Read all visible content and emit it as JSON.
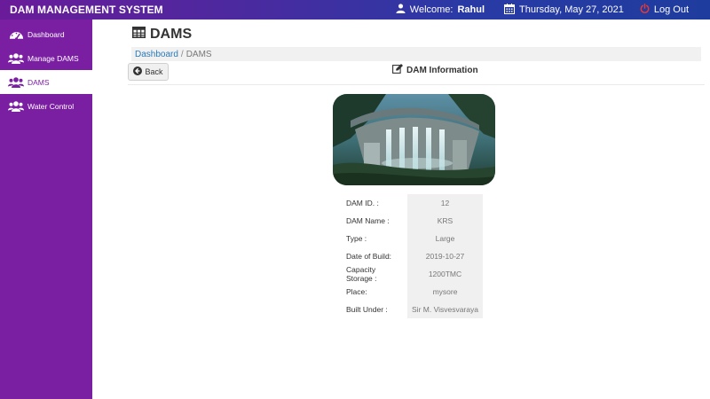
{
  "header": {
    "brand": "DAM MANAGEMENT SYSTEM",
    "welcome_prefix": "Welcome:",
    "user": "Rahul",
    "date": "Thursday, May 27, 2021",
    "logout": "Log Out"
  },
  "sidebar": {
    "items": [
      {
        "label": "Dashboard",
        "icon": "dashboard-icon"
      },
      {
        "label": "Manage DAMS",
        "icon": "users-icon"
      },
      {
        "label": "DAMS",
        "icon": "users-icon",
        "active": true
      },
      {
        "label": "Water Control",
        "icon": "users-icon"
      }
    ]
  },
  "page": {
    "title": "DAMS",
    "breadcrumb": {
      "link": "Dashboard",
      "sep": "/",
      "current": "DAMS"
    },
    "back_label": "Back",
    "section_title": "DAM Information"
  },
  "dam": {
    "rows": [
      {
        "label": "DAM ID. :",
        "value": "12"
      },
      {
        "label": "DAM Name :",
        "value": "KRS"
      },
      {
        "label": "Type :",
        "value": "Large"
      },
      {
        "label": "Date of Build:",
        "value": "2019-10-27"
      },
      {
        "label": "Capacity Storage :",
        "value": "1200TMC"
      },
      {
        "label": "Place:",
        "value": "mysore"
      },
      {
        "label": "Built Under :",
        "value": "Sir M. Visvesvaraya"
      }
    ]
  },
  "colors": {
    "sidebar": "#7b1fa2",
    "header_start": "#6a1b9a",
    "header_end": "#1e3c9e",
    "logout_icon": "#e53935",
    "link": "#2a7ab8"
  }
}
